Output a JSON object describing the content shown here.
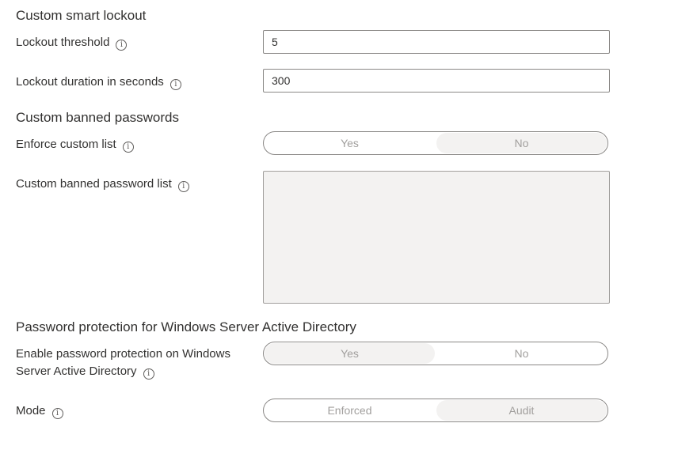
{
  "lockout": {
    "title": "Custom smart lockout",
    "threshold_label": "Lockout threshold",
    "threshold_value": "5",
    "duration_label": "Lockout duration in seconds",
    "duration_value": "300"
  },
  "banned": {
    "title": "Custom banned passwords",
    "enforce_label": "Enforce custom list",
    "enforce_options": {
      "yes": "Yes",
      "no": "No"
    },
    "enforce_selected": "No",
    "list_label": "Custom banned password list",
    "list_value": ""
  },
  "ad": {
    "title": "Password protection for Windows Server Active Directory",
    "enable_label_line1": "Enable password protection on Windows",
    "enable_label_line2": "Server Active Directory",
    "enable_options": {
      "yes": "Yes",
      "no": "No"
    },
    "enable_selected": "Yes",
    "mode_label": "Mode",
    "mode_options": {
      "enforced": "Enforced",
      "audit": "Audit"
    },
    "mode_selected": "Audit"
  },
  "info_glyph": "i"
}
